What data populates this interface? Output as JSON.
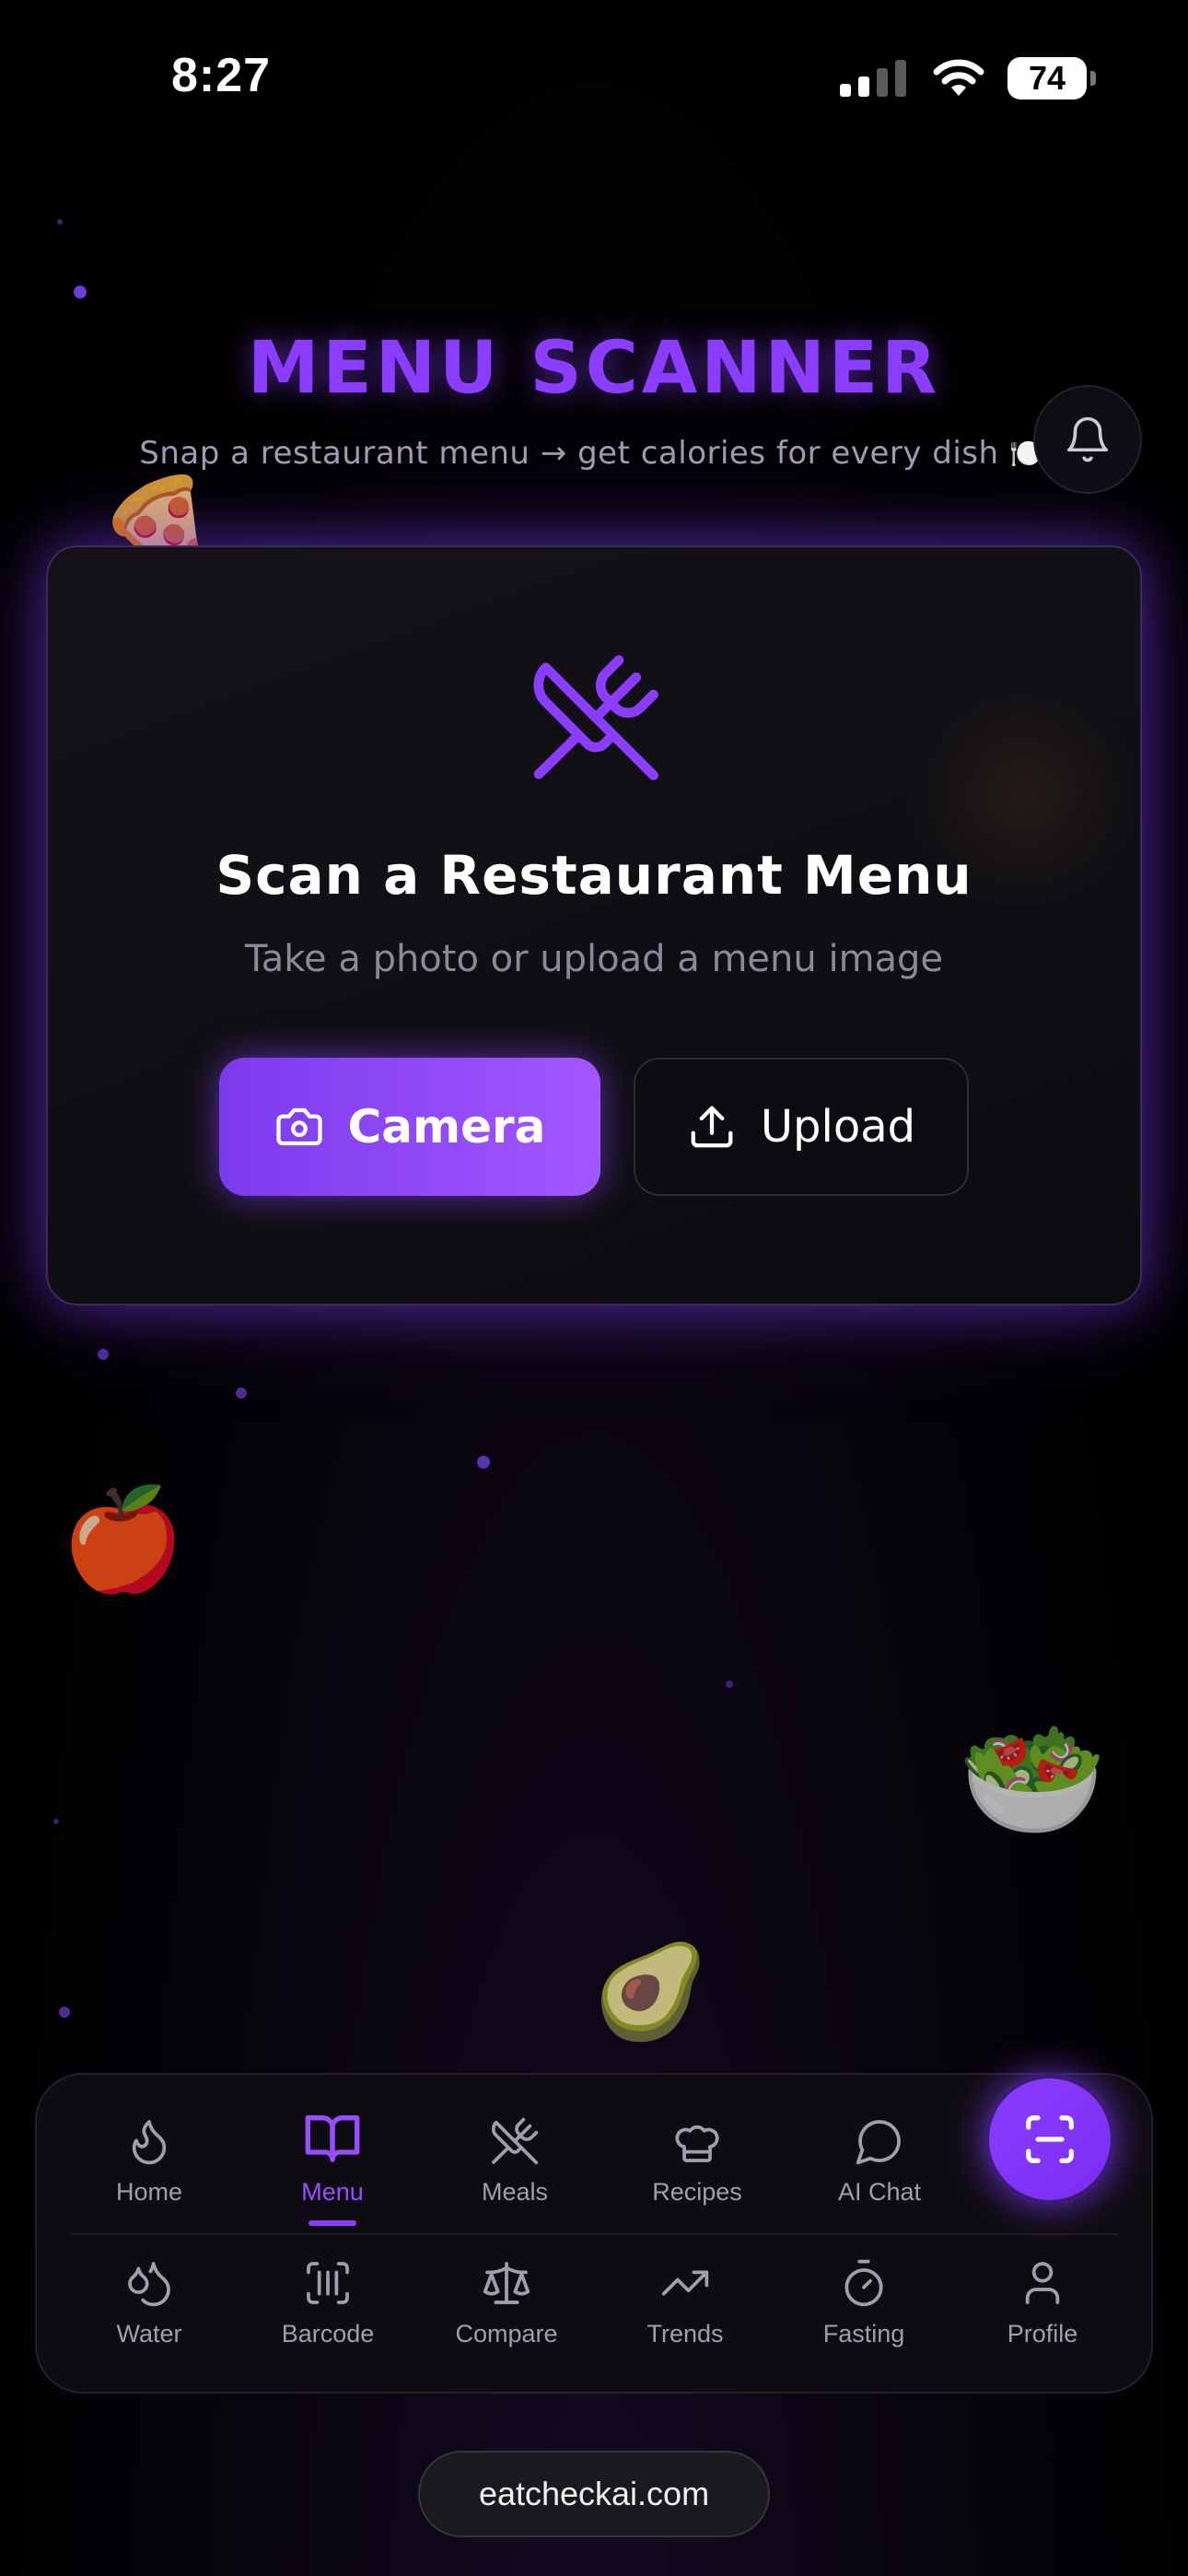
{
  "status_bar": {
    "time": "8:27",
    "battery": "74"
  },
  "header": {
    "title": "MENU SCANNER",
    "subtitle": "Snap a restaurant menu → get calories for every dish 🍽️"
  },
  "card": {
    "title": "Scan a Restaurant Menu",
    "subtitle": "Take a photo or upload a menu image",
    "camera_label": "Camera",
    "upload_label": "Upload"
  },
  "food_emojis": {
    "pizza": "🍕",
    "apple": "🍎",
    "salad": "🥗",
    "avocado": "🥑"
  },
  "nav": {
    "row1": [
      {
        "label": "Home",
        "icon": "flame-icon"
      },
      {
        "label": "Menu",
        "icon": "book-icon",
        "active": true
      },
      {
        "label": "Meals",
        "icon": "utensils-icon"
      },
      {
        "label": "Recipes",
        "icon": "chef-hat-icon"
      },
      {
        "label": "AI Chat",
        "icon": "chat-icon"
      }
    ],
    "row2": [
      {
        "label": "Water",
        "icon": "droplets-icon"
      },
      {
        "label": "Barcode",
        "icon": "barcode-icon"
      },
      {
        "label": "Compare",
        "icon": "scale-icon"
      },
      {
        "label": "Trends",
        "icon": "trending-up-icon"
      },
      {
        "label": "Fasting",
        "icon": "timer-icon"
      },
      {
        "label": "Profile",
        "icon": "user-icon"
      }
    ]
  },
  "footer": {
    "site": "eatcheckai.com"
  },
  "colors": {
    "accent": "#8b3dff",
    "background": "#000000",
    "muted_text": "#a39eab"
  }
}
